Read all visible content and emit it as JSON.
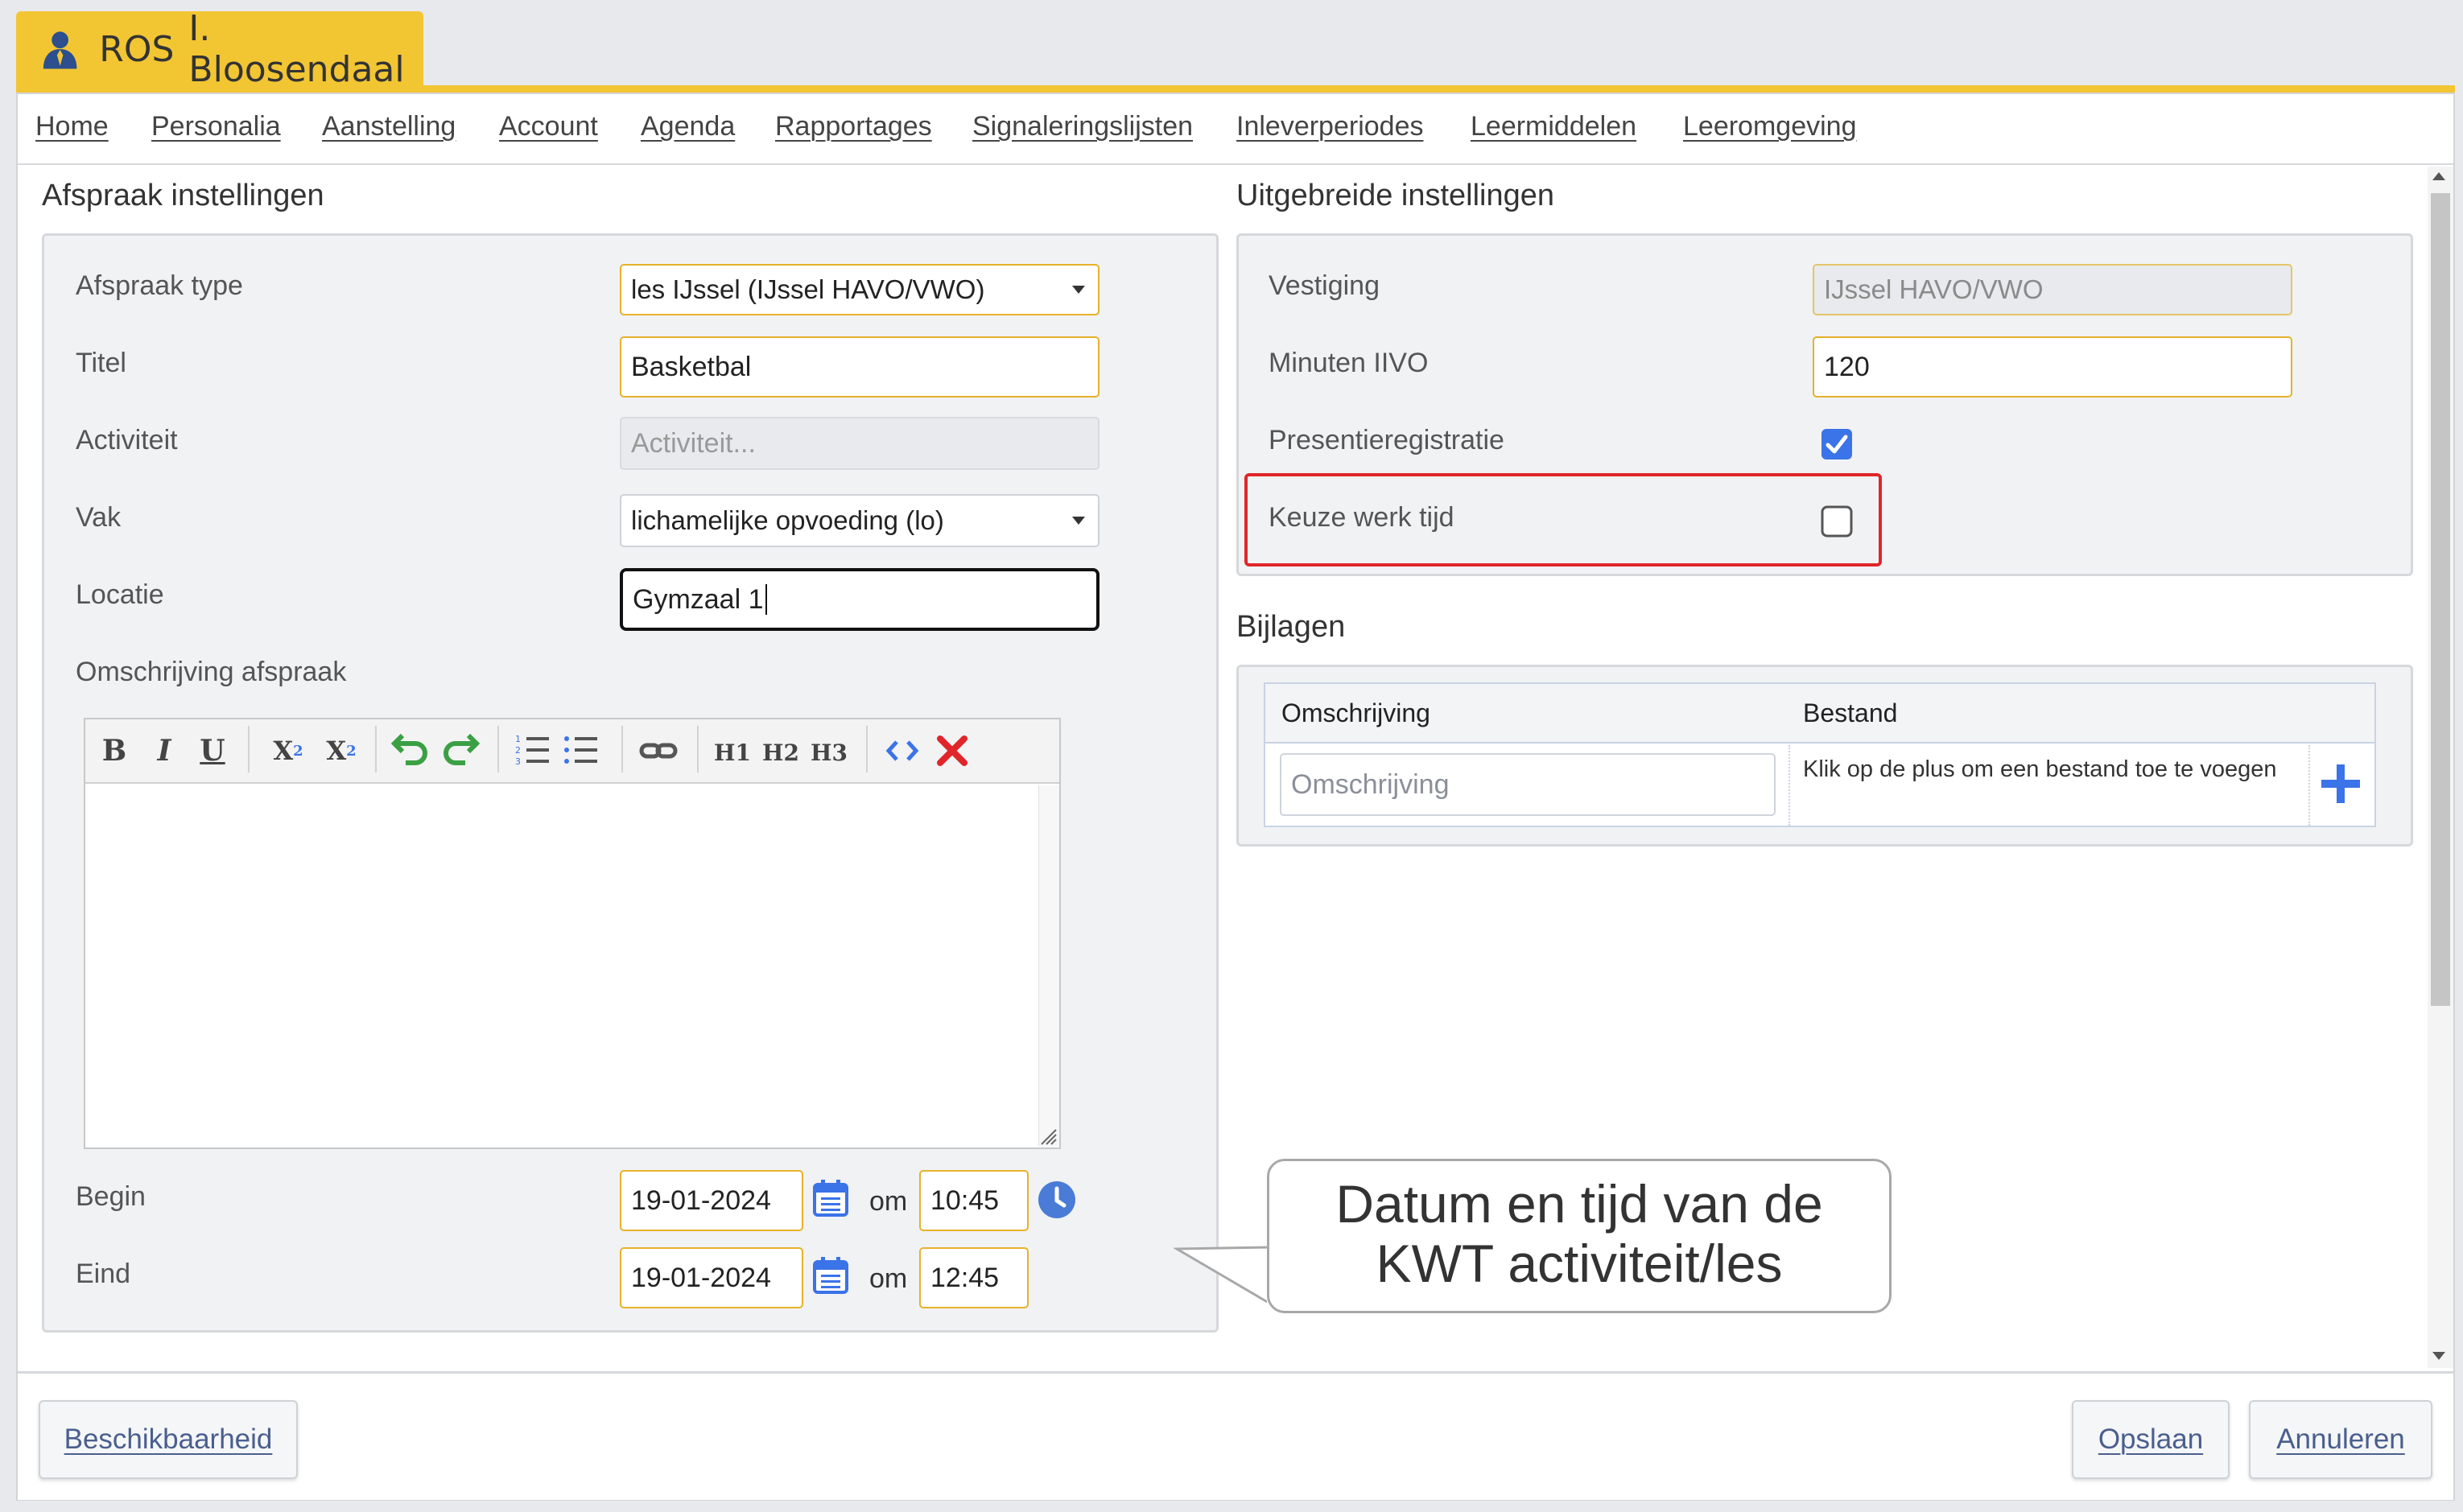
{
  "app_tab": {
    "code": "ROS",
    "name": "I. Bloosendaal"
  },
  "menu": [
    "Home",
    "Personalia",
    "Aanstelling",
    "Account",
    "Agenda",
    "Rapportages",
    "Signaleringslijsten",
    "Inleverperiodes",
    "Leermiddelen",
    "Leeromgeving"
  ],
  "left": {
    "title": "Afspraak instellingen",
    "afspraak_type": {
      "label": "Afspraak type",
      "value": "les IJssel (IJssel HAVO/VWO)"
    },
    "titel": {
      "label": "Titel",
      "value": "Basketbal"
    },
    "activiteit": {
      "label": "Activiteit",
      "placeholder": "Activiteit..."
    },
    "vak": {
      "label": "Vak",
      "value": "lichamelijke opvoeding (lo)"
    },
    "locatie": {
      "label": "Locatie",
      "value": "Gymzaal 1"
    },
    "omschrijving_label": "Omschrijving afspraak",
    "toolbar": {
      "h1": "H1",
      "h2": "H2",
      "h3": "H3"
    },
    "begin": {
      "label": "Begin",
      "date": "19-01-2024",
      "om": "om",
      "time": "10:45"
    },
    "eind": {
      "label": "Eind",
      "date": "19-01-2024",
      "om": "om",
      "time": "12:45"
    }
  },
  "right": {
    "title": "Uitgebreide instellingen",
    "vestiging": {
      "label": "Vestiging",
      "value": "IJssel HAVO/VWO"
    },
    "minuten": {
      "label": "Minuten IIVO",
      "value": "120"
    },
    "presentie": {
      "label": "Presentieregistratie",
      "checked": true
    },
    "keuze": {
      "label": "Keuze werk tijd",
      "checked": false
    },
    "bijlagen_title": "Bijlagen",
    "bijlagen": {
      "col1": "Omschrijving",
      "col2": "Bestand",
      "input_placeholder": "Omschrijving",
      "hint": "Klik op de plus om een bestand toe te voegen"
    }
  },
  "callout": "Datum en tijd van de\nKWT activiteit/les",
  "footer": {
    "beschikbaarheid": "Beschikbaarheid",
    "opslaan": "Opslaan",
    "annuleren": "Annuleren"
  },
  "colors": {
    "accent": "#f2c533",
    "link": "#4a5f8e",
    "highlight_red": "#e0262b",
    "checkbox_blue": "#3b73e8"
  }
}
